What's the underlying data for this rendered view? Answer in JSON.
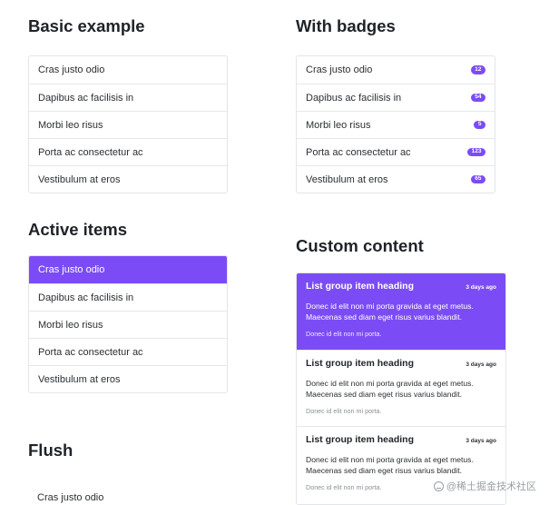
{
  "basic": {
    "title": "Basic example",
    "items": [
      "Cras justo odio",
      "Dapibus ac facilisis in",
      "Morbi leo risus",
      "Porta ac consectetur ac",
      "Vestibulum at eros"
    ]
  },
  "badges": {
    "title": "With badges",
    "items": [
      {
        "label": "Cras justo odio",
        "badge": "12"
      },
      {
        "label": "Dapibus ac facilisis in",
        "badge": "54"
      },
      {
        "label": "Morbi leo risus",
        "badge": "5"
      },
      {
        "label": "Porta ac consectetur ac",
        "badge": "123"
      },
      {
        "label": "Vestibulum at eros",
        "badge": "65"
      }
    ]
  },
  "active": {
    "title": "Active items",
    "items": [
      "Cras justo odio",
      "Dapibus ac facilisis in",
      "Morbi leo risus",
      "Porta ac consectetur ac",
      "Vestibulum at eros"
    ],
    "active_index": 0
  },
  "custom": {
    "title": "Custom content",
    "items": [
      {
        "heading": "List group item heading",
        "time": "3 days ago",
        "body": "Donec id elit non mi porta gravida at eget metus. Maecenas sed diam eget risus varius blandit.",
        "small": "Donec id elit non mi porta."
      },
      {
        "heading": "List group item heading",
        "time": "3 days ago",
        "body": "Donec id elit non mi porta gravida at eget metus. Maecenas sed diam eget risus varius blandit.",
        "small": "Donec id elit non mi porta."
      },
      {
        "heading": "List group item heading",
        "time": "3 days ago",
        "body": "Donec id elit non mi porta gravida at eget metus. Maecenas sed diam eget risus varius blandit.",
        "small": "Donec id elit non mi porta."
      }
    ]
  },
  "flush": {
    "title": "Flush",
    "items": [
      "Cras justo odio"
    ]
  },
  "watermark": {
    "text": "@稀土掘金技术社区"
  },
  "colors": {
    "accent": "#7b4cf5",
    "border": "#e3e5e8",
    "text": "#212529"
  }
}
